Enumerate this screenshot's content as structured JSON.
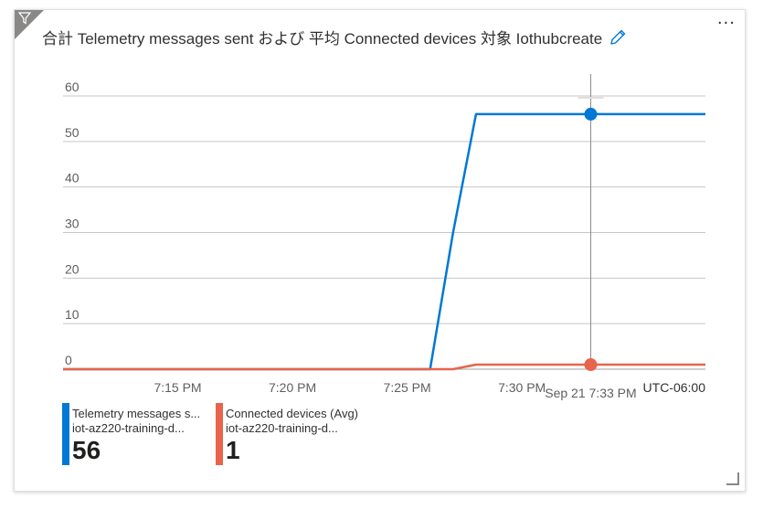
{
  "title": "合計 Telemetry messages sent および 平均 Connected devices 対象 Iothubcreate",
  "timezone": "UTC-06:00",
  "hover_label": "Sep 21 7:33 PM",
  "colors": {
    "series1": "#0078d4",
    "series2": "#e8644b",
    "grid": "#c8c6c4",
    "cursor": "#8a8886"
  },
  "legend": [
    {
      "name": "Telemetry messages s...",
      "resource": "iot-az220-training-d...",
      "value": "56"
    },
    {
      "name": "Connected devices (Avg)",
      "resource": "iot-az220-training-d...",
      "value": "1"
    }
  ],
  "chart_data": {
    "type": "line",
    "title": "合計 Telemetry messages sent および 平均 Connected devices 対象 Iothubcreate",
    "x_unit": "minutes",
    "xlim": [
      "7:10 PM",
      "7:38 PM"
    ],
    "ylim": [
      0,
      60
    ],
    "y_ticks": [
      0,
      10,
      20,
      30,
      40,
      50,
      60
    ],
    "x_ticks": [
      {
        "t": "7:15 PM",
        "label": "7:15 PM"
      },
      {
        "t": "7:20 PM",
        "label": "7:20 PM"
      },
      {
        "t": "7:25 PM",
        "label": "7:25 PM"
      },
      {
        "t": "7:30 PM",
        "label": "7:30 PM"
      }
    ],
    "hover_t": "7:33 PM",
    "grid": true,
    "series": [
      {
        "name": "Telemetry messages sent (Sum)",
        "x": [
          "7:10 PM",
          "7:26 PM",
          "7:27 PM",
          "7:28 PM",
          "7:33 PM",
          "7:38 PM"
        ],
        "y": [
          0,
          0,
          30,
          56,
          56,
          56
        ]
      },
      {
        "name": "Connected devices (Avg)",
        "x": [
          "7:10 PM",
          "7:27 PM",
          "7:28 PM",
          "7:33 PM",
          "7:38 PM"
        ],
        "y": [
          0,
          0,
          1,
          1,
          1
        ]
      }
    ]
  }
}
